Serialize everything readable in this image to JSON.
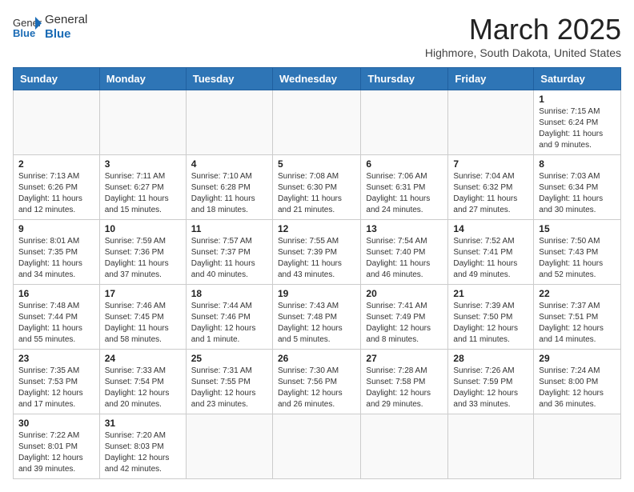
{
  "header": {
    "logo_general": "General",
    "logo_blue": "Blue",
    "month_title": "March 2025",
    "subtitle": "Highmore, South Dakota, United States"
  },
  "days_of_week": [
    "Sunday",
    "Monday",
    "Tuesday",
    "Wednesday",
    "Thursday",
    "Friday",
    "Saturday"
  ],
  "weeks": [
    [
      {
        "day": "",
        "info": ""
      },
      {
        "day": "",
        "info": ""
      },
      {
        "day": "",
        "info": ""
      },
      {
        "day": "",
        "info": ""
      },
      {
        "day": "",
        "info": ""
      },
      {
        "day": "",
        "info": ""
      },
      {
        "day": "1",
        "info": "Sunrise: 7:15 AM\nSunset: 6:24 PM\nDaylight: 11 hours\nand 9 minutes."
      }
    ],
    [
      {
        "day": "2",
        "info": "Sunrise: 7:13 AM\nSunset: 6:26 PM\nDaylight: 11 hours\nand 12 minutes."
      },
      {
        "day": "3",
        "info": "Sunrise: 7:11 AM\nSunset: 6:27 PM\nDaylight: 11 hours\nand 15 minutes."
      },
      {
        "day": "4",
        "info": "Sunrise: 7:10 AM\nSunset: 6:28 PM\nDaylight: 11 hours\nand 18 minutes."
      },
      {
        "day": "5",
        "info": "Sunrise: 7:08 AM\nSunset: 6:30 PM\nDaylight: 11 hours\nand 21 minutes."
      },
      {
        "day": "6",
        "info": "Sunrise: 7:06 AM\nSunset: 6:31 PM\nDaylight: 11 hours\nand 24 minutes."
      },
      {
        "day": "7",
        "info": "Sunrise: 7:04 AM\nSunset: 6:32 PM\nDaylight: 11 hours\nand 27 minutes."
      },
      {
        "day": "8",
        "info": "Sunrise: 7:03 AM\nSunset: 6:34 PM\nDaylight: 11 hours\nand 30 minutes."
      }
    ],
    [
      {
        "day": "9",
        "info": "Sunrise: 8:01 AM\nSunset: 7:35 PM\nDaylight: 11 hours\nand 34 minutes."
      },
      {
        "day": "10",
        "info": "Sunrise: 7:59 AM\nSunset: 7:36 PM\nDaylight: 11 hours\nand 37 minutes."
      },
      {
        "day": "11",
        "info": "Sunrise: 7:57 AM\nSunset: 7:37 PM\nDaylight: 11 hours\nand 40 minutes."
      },
      {
        "day": "12",
        "info": "Sunrise: 7:55 AM\nSunset: 7:39 PM\nDaylight: 11 hours\nand 43 minutes."
      },
      {
        "day": "13",
        "info": "Sunrise: 7:54 AM\nSunset: 7:40 PM\nDaylight: 11 hours\nand 46 minutes."
      },
      {
        "day": "14",
        "info": "Sunrise: 7:52 AM\nSunset: 7:41 PM\nDaylight: 11 hours\nand 49 minutes."
      },
      {
        "day": "15",
        "info": "Sunrise: 7:50 AM\nSunset: 7:43 PM\nDaylight: 11 hours\nand 52 minutes."
      }
    ],
    [
      {
        "day": "16",
        "info": "Sunrise: 7:48 AM\nSunset: 7:44 PM\nDaylight: 11 hours\nand 55 minutes."
      },
      {
        "day": "17",
        "info": "Sunrise: 7:46 AM\nSunset: 7:45 PM\nDaylight: 11 hours\nand 58 minutes."
      },
      {
        "day": "18",
        "info": "Sunrise: 7:44 AM\nSunset: 7:46 PM\nDaylight: 12 hours\nand 1 minute."
      },
      {
        "day": "19",
        "info": "Sunrise: 7:43 AM\nSunset: 7:48 PM\nDaylight: 12 hours\nand 5 minutes."
      },
      {
        "day": "20",
        "info": "Sunrise: 7:41 AM\nSunset: 7:49 PM\nDaylight: 12 hours\nand 8 minutes."
      },
      {
        "day": "21",
        "info": "Sunrise: 7:39 AM\nSunset: 7:50 PM\nDaylight: 12 hours\nand 11 minutes."
      },
      {
        "day": "22",
        "info": "Sunrise: 7:37 AM\nSunset: 7:51 PM\nDaylight: 12 hours\nand 14 minutes."
      }
    ],
    [
      {
        "day": "23",
        "info": "Sunrise: 7:35 AM\nSunset: 7:53 PM\nDaylight: 12 hours\nand 17 minutes."
      },
      {
        "day": "24",
        "info": "Sunrise: 7:33 AM\nSunset: 7:54 PM\nDaylight: 12 hours\nand 20 minutes."
      },
      {
        "day": "25",
        "info": "Sunrise: 7:31 AM\nSunset: 7:55 PM\nDaylight: 12 hours\nand 23 minutes."
      },
      {
        "day": "26",
        "info": "Sunrise: 7:30 AM\nSunset: 7:56 PM\nDaylight: 12 hours\nand 26 minutes."
      },
      {
        "day": "27",
        "info": "Sunrise: 7:28 AM\nSunset: 7:58 PM\nDaylight: 12 hours\nand 29 minutes."
      },
      {
        "day": "28",
        "info": "Sunrise: 7:26 AM\nSunset: 7:59 PM\nDaylight: 12 hours\nand 33 minutes."
      },
      {
        "day": "29",
        "info": "Sunrise: 7:24 AM\nSunset: 8:00 PM\nDaylight: 12 hours\nand 36 minutes."
      }
    ],
    [
      {
        "day": "30",
        "info": "Sunrise: 7:22 AM\nSunset: 8:01 PM\nDaylight: 12 hours\nand 39 minutes."
      },
      {
        "day": "31",
        "info": "Sunrise: 7:20 AM\nSunset: 8:03 PM\nDaylight: 12 hours\nand 42 minutes."
      },
      {
        "day": "",
        "info": ""
      },
      {
        "day": "",
        "info": ""
      },
      {
        "day": "",
        "info": ""
      },
      {
        "day": "",
        "info": ""
      },
      {
        "day": "",
        "info": ""
      }
    ]
  ]
}
